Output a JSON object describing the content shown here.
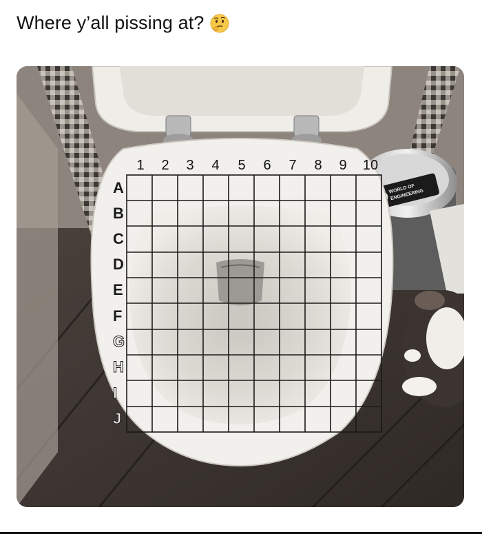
{
  "post": {
    "caption": "Where y’all pissing at?",
    "emoji": "thinking-face-icon"
  },
  "grid": {
    "columns": [
      "1",
      "2",
      "3",
      "4",
      "5",
      "6",
      "7",
      "8",
      "9",
      "10"
    ],
    "rows": [
      "A",
      "B",
      "C",
      "D",
      "E",
      "F",
      "G",
      "H",
      "I",
      "J"
    ]
  },
  "sticker": {
    "line1": "WORLD OF",
    "line2": "ENGINEERING"
  },
  "colors": {
    "floor": "#3a3330",
    "wall": "#8a8079",
    "porcelain": "#e9e7e2",
    "grid_line": "#1a1a1a"
  }
}
